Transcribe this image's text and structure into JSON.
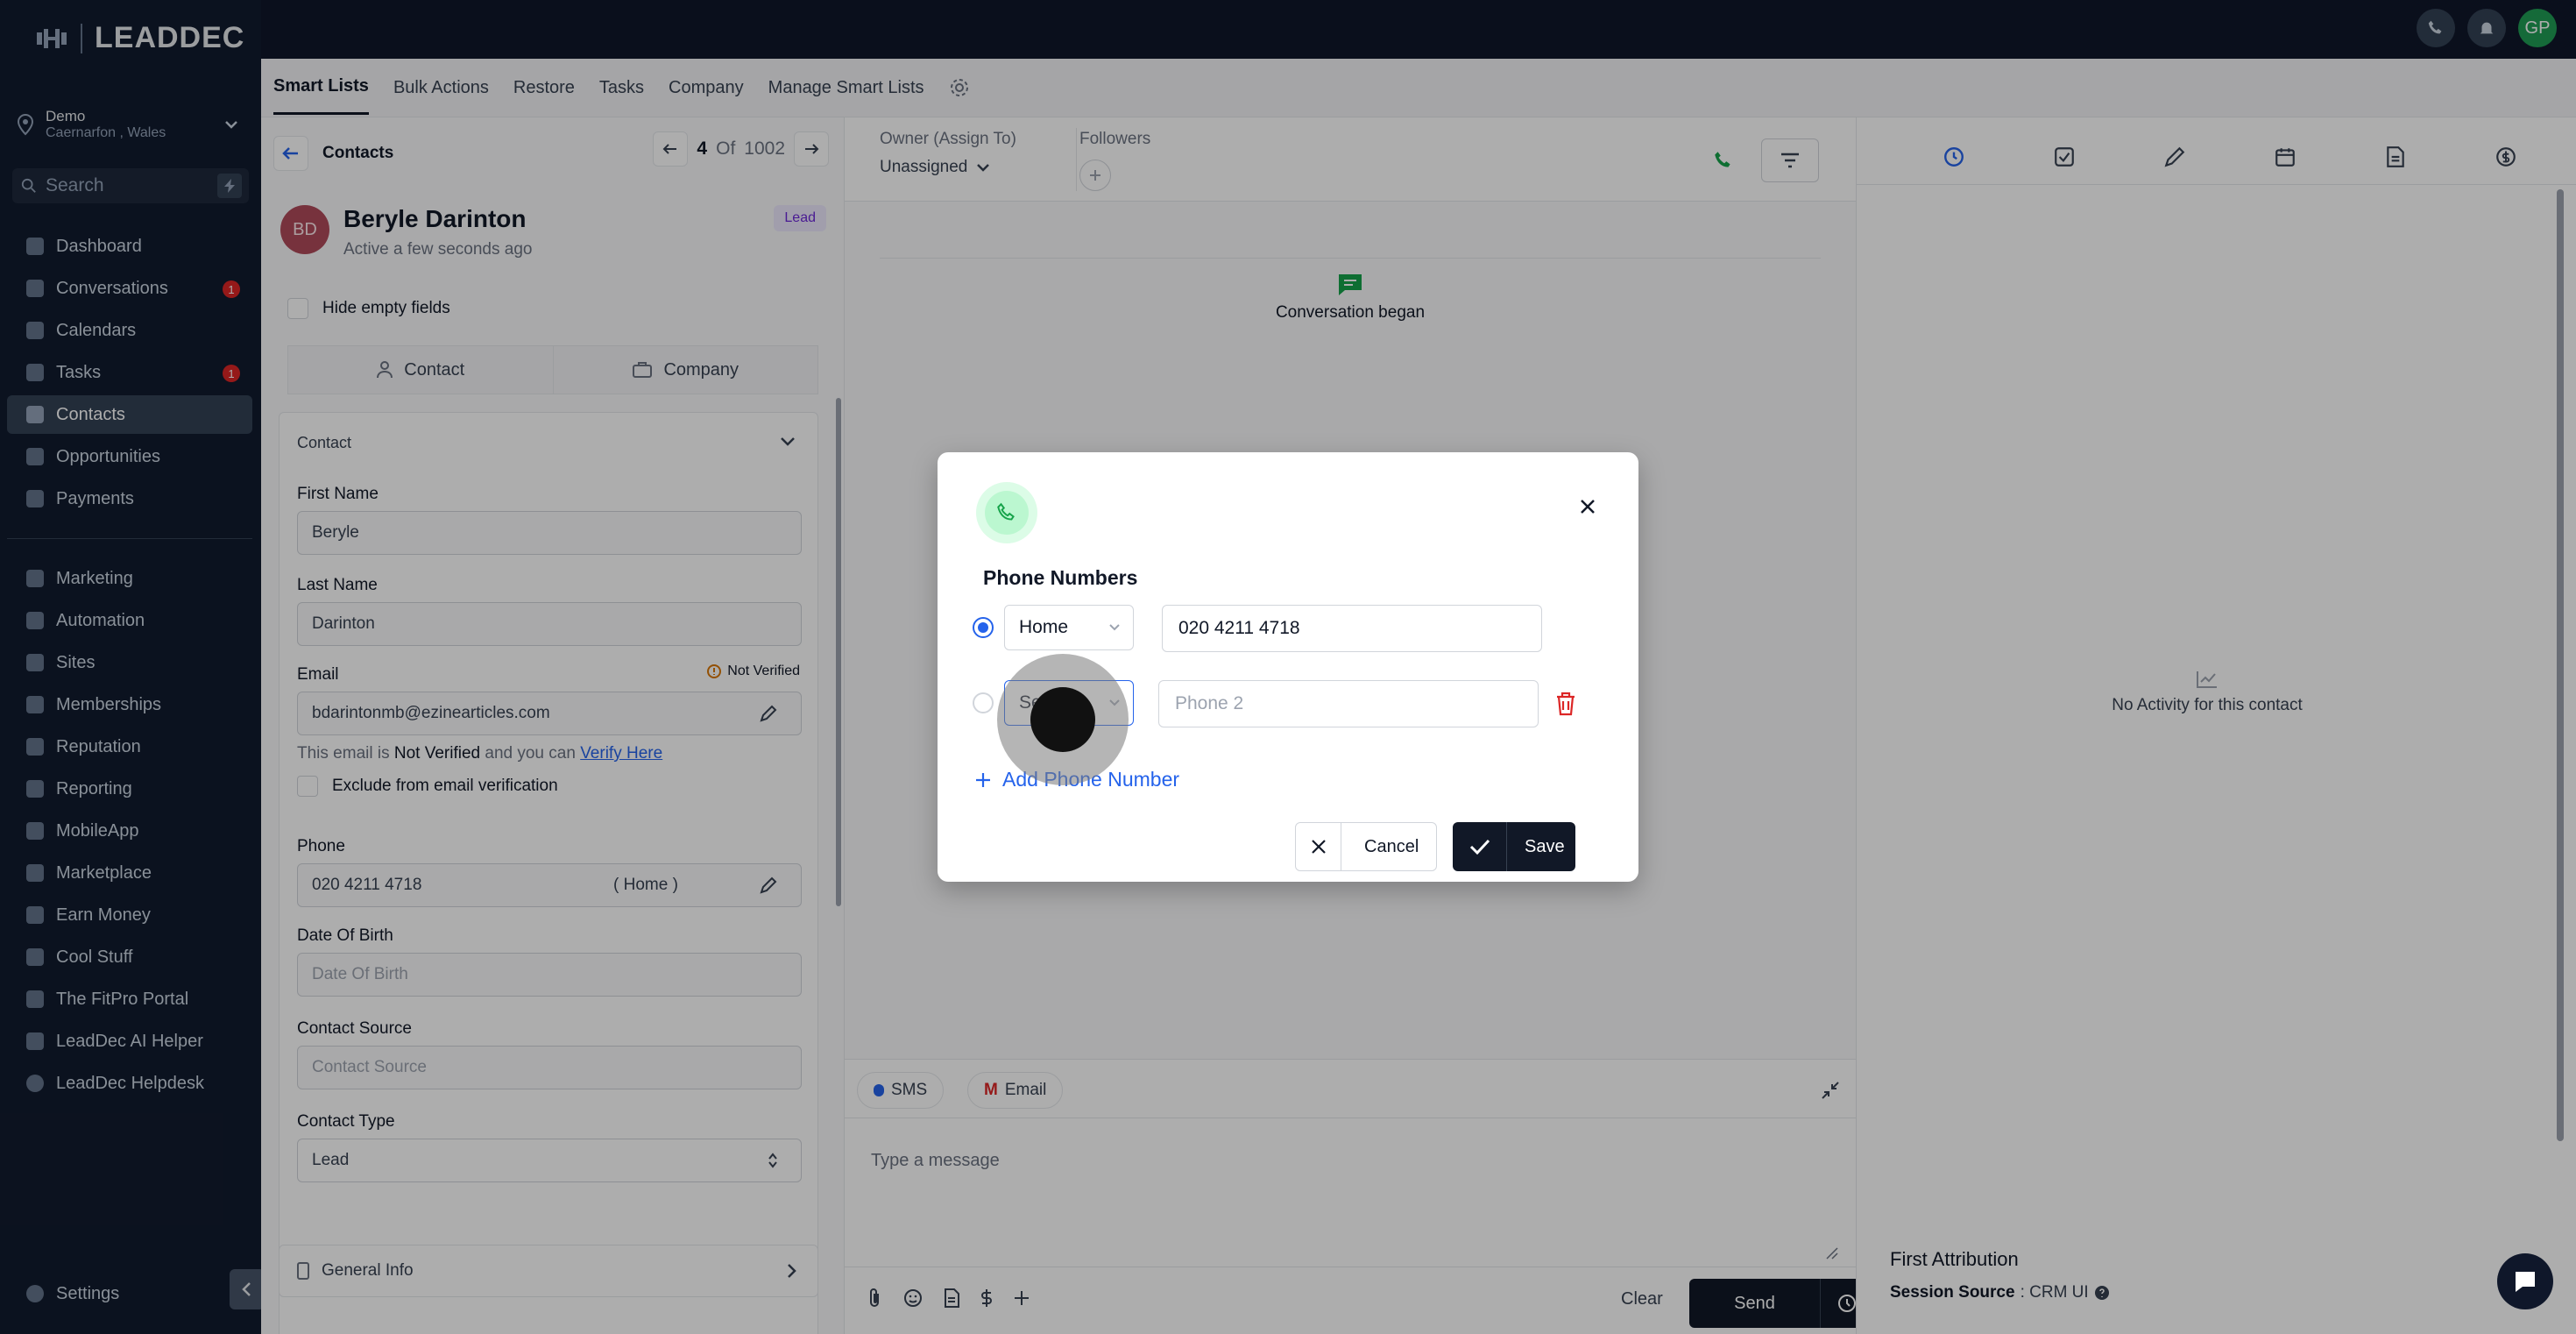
{
  "brand": {
    "logo_text": "LEADDEC"
  },
  "location": {
    "name": "Demo",
    "sub": "Caernarfon , Wales"
  },
  "search": {
    "placeholder": "Search"
  },
  "nav": {
    "items": [
      {
        "label": "Dashboard",
        "badge": ""
      },
      {
        "label": "Conversations",
        "badge": "1"
      },
      {
        "label": "Calendars",
        "badge": ""
      },
      {
        "label": "Tasks",
        "badge": "1"
      },
      {
        "label": "Contacts",
        "badge": ""
      },
      {
        "label": "Opportunities",
        "badge": ""
      },
      {
        "label": "Payments",
        "badge": ""
      },
      {
        "label": "Marketing",
        "badge": ""
      },
      {
        "label": "Automation",
        "badge": ""
      },
      {
        "label": "Sites",
        "badge": ""
      },
      {
        "label": "Memberships",
        "badge": ""
      },
      {
        "label": "Reputation",
        "badge": ""
      },
      {
        "label": "Reporting",
        "badge": ""
      },
      {
        "label": "MobileApp",
        "badge": ""
      },
      {
        "label": "Marketplace",
        "badge": ""
      },
      {
        "label": "Earn Money",
        "badge": ""
      },
      {
        "label": "Cool Stuff",
        "badge": ""
      },
      {
        "label": "The FitPro Portal",
        "badge": ""
      },
      {
        "label": "LeadDec AI Helper",
        "badge": ""
      },
      {
        "label": "LeadDec Helpdesk",
        "badge": ""
      }
    ],
    "active": "Contacts",
    "settings": "Settings"
  },
  "topbar": {
    "avatar_initials": "GP"
  },
  "tabs": [
    "Smart Lists",
    "Bulk Actions",
    "Restore",
    "Tasks",
    "Company",
    "Manage Smart Lists"
  ],
  "contact": {
    "breadcrumb": "Contacts",
    "pager_current": "4",
    "pager_of": "Of",
    "pager_total": "1002",
    "initials": "BD",
    "name": "Beryle Darinton",
    "status": "Active a few seconds ago",
    "tag": "Lead",
    "hide_empty": "Hide empty fields",
    "tab_contact": "Contact",
    "tab_company": "Company",
    "section": "Contact",
    "first_name_label": "First Name",
    "first_name": "Beryle",
    "last_name_label": "Last Name",
    "last_name": "Darinton",
    "email_label": "Email",
    "not_verified": "Not Verified",
    "email": "bdarintonmb@ezinearticles.com",
    "email_note_pre": "This email is",
    "email_note_bold": "Not Verified",
    "email_note_post": "and you can",
    "verify_link": "Verify Here",
    "exclude_label": "Exclude from email verification",
    "phone_label": "Phone",
    "phone": "020 4211 4718",
    "phone_type": "( Home )",
    "dob_label": "Date Of Birth",
    "dob_placeholder": "Date Of Birth",
    "source_label": "Contact Source",
    "source_placeholder": "Contact Source",
    "type_label": "Contact Type",
    "type_value": "Lead",
    "general_info": "General Info"
  },
  "conversation": {
    "owner_label": "Owner (Assign To)",
    "owner_value": "Unassigned",
    "followers_label": "Followers",
    "began": "Conversation began",
    "sms": "SMS",
    "email": "Email",
    "message_placeholder": "Type a message",
    "clear": "Clear",
    "send": "Send"
  },
  "activity": {
    "empty": "No Activity for this contact",
    "attribution_title": "First Attribution",
    "session_label": "Session Source",
    "session_value": ": CRM UI"
  },
  "modal": {
    "title": "Phone Numbers",
    "row1_type": "Home",
    "row1_value": "020 4211 4718",
    "row2_type": "Se",
    "row2_placeholder": "Phone 2",
    "add_label": "Add Phone Number",
    "cancel": "Cancel",
    "save": "Save"
  },
  "colors": {
    "sidebar": "#111b2e",
    "topbar": "#0f172a",
    "accent": "#2563eb",
    "danger": "#dc2626",
    "success": "#16a34a"
  }
}
